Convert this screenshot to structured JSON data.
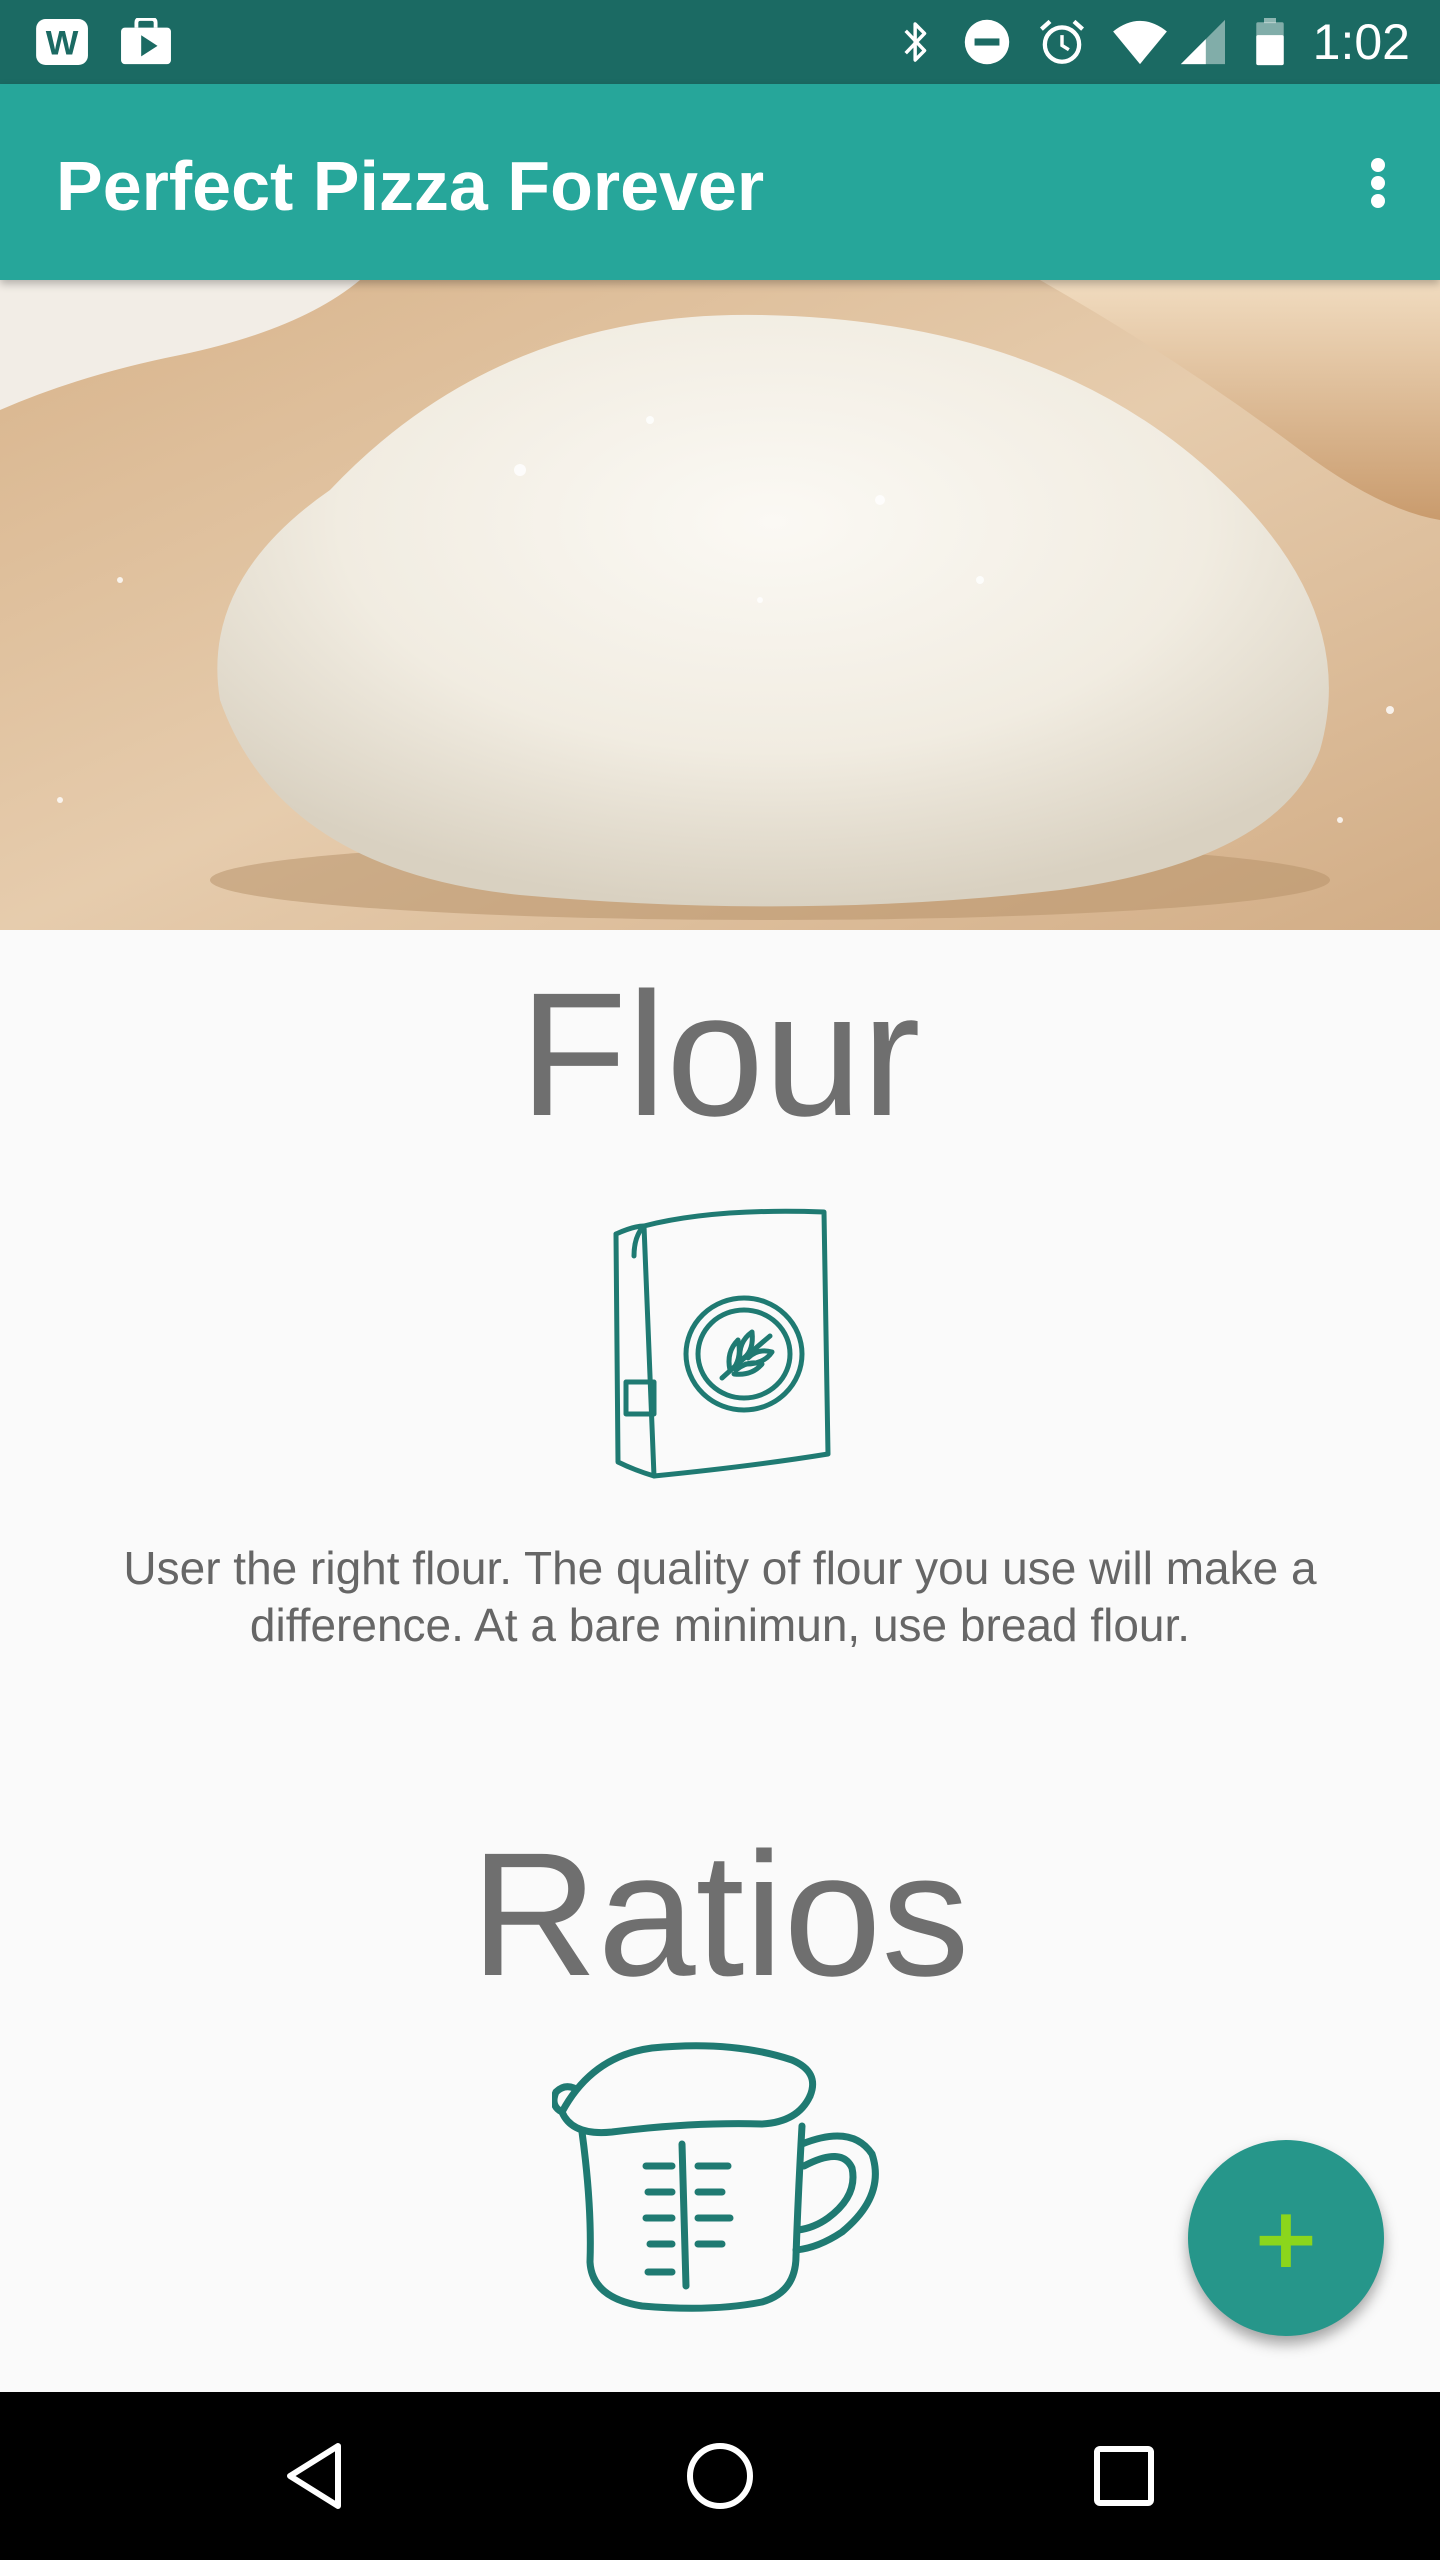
{
  "status_bar": {
    "time": "1:02",
    "left_icons": [
      "w-app-icon",
      "shopping-bag-play-icon"
    ],
    "right_icons": [
      "bluetooth-icon",
      "do-not-disturb-icon",
      "alarm-icon",
      "wifi-icon",
      "cell-signal-icon",
      "battery-icon"
    ]
  },
  "app_bar": {
    "title": "Perfect Pizza Forever",
    "overflow_icon": "more-vert-icon"
  },
  "hero": {
    "image": "pizza-dough-photo"
  },
  "sections": [
    {
      "title": "Flour",
      "icon": "flour-bag-icon",
      "text": "User the right flour. The quality of flour you use will make a difference. At a bare minimun, use bread flour."
    },
    {
      "title": "Ratios",
      "icon": "measuring-cup-icon"
    }
  ],
  "fab": {
    "label": "+",
    "icon": "add-icon"
  },
  "nav_bar": {
    "buttons": [
      "back-icon",
      "home-icon",
      "recents-icon"
    ]
  },
  "colors": {
    "status_bar": "#1b6a63",
    "app_bar": "#26a69a",
    "icon_stroke": "#1f7a72",
    "fab": "#26968a",
    "fab_plus": "#8bd61c",
    "body_text": "#666666",
    "background": "#fafafa"
  }
}
